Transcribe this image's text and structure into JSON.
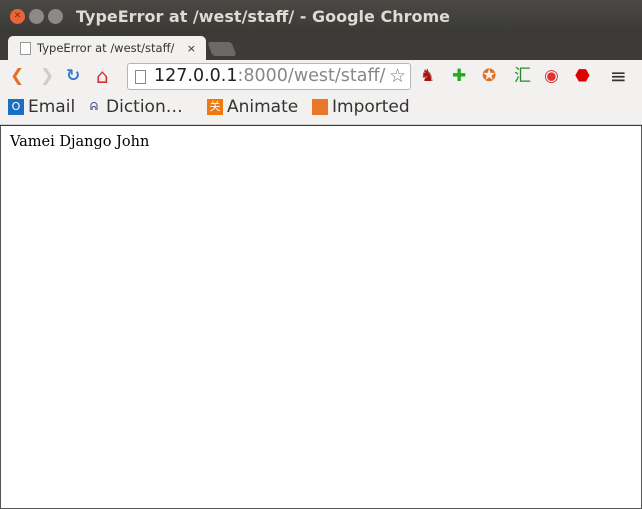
{
  "window": {
    "title": "TypeError at /west/staff/ - Google Chrome"
  },
  "tabs": [
    {
      "label": "TypeError at /west/staff/",
      "close": "×"
    }
  ],
  "toolbar": {
    "url_host": "127.0.0.1",
    "url_rest": ":8000/west/staff/",
    "back": "❮",
    "forward": "❯",
    "reload": "↻",
    "home": "⌂",
    "star": "☆",
    "menu": "≡",
    "extensions": [
      {
        "name": "sofa-icon",
        "glyph": "♞",
        "color": "#a11"
      },
      {
        "name": "evernote-icon",
        "glyph": "✚",
        "color": "#2a2"
      },
      {
        "name": "fox-icon",
        "glyph": "✪",
        "color": "#e07020"
      },
      {
        "name": "hui-icon",
        "glyph": "汇",
        "color": "#2a8a2a"
      },
      {
        "name": "chrome-ext-icon",
        "glyph": "◉",
        "color": "#d33"
      },
      {
        "name": "adblock-icon",
        "glyph": "⬣",
        "color": "#d00"
      }
    ]
  },
  "bookmarks": [
    {
      "label": "Email",
      "icon": "outlook-icon",
      "color": "#1a6fc2",
      "glyph": "O"
    },
    {
      "label": "Diction…",
      "icon": "dictionary-icon",
      "color": "#2a4a7a",
      "glyph": "ᕱ"
    },
    {
      "label": "Animate",
      "icon": "animate-icon",
      "color": "#f07a10",
      "glyph": "关"
    },
    {
      "label": "Imported",
      "icon": "folder-icon",
      "color": "#e8782a",
      "glyph": ""
    }
  ],
  "content": {
    "text": "Vamei Django John"
  }
}
